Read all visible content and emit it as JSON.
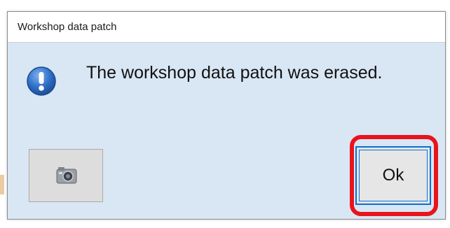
{
  "dialog": {
    "title": "Workshop data patch",
    "message": "The workshop data patch was erased.",
    "icon": "info-icon"
  },
  "buttons": {
    "screenshot_icon": "camera-icon",
    "ok_label": "Ok"
  },
  "colors": {
    "dialog_background": "#d9e6f4",
    "highlight": "#e8141b",
    "focus_border": "#0a6fd8",
    "info_icon": "#2f6fc6"
  }
}
